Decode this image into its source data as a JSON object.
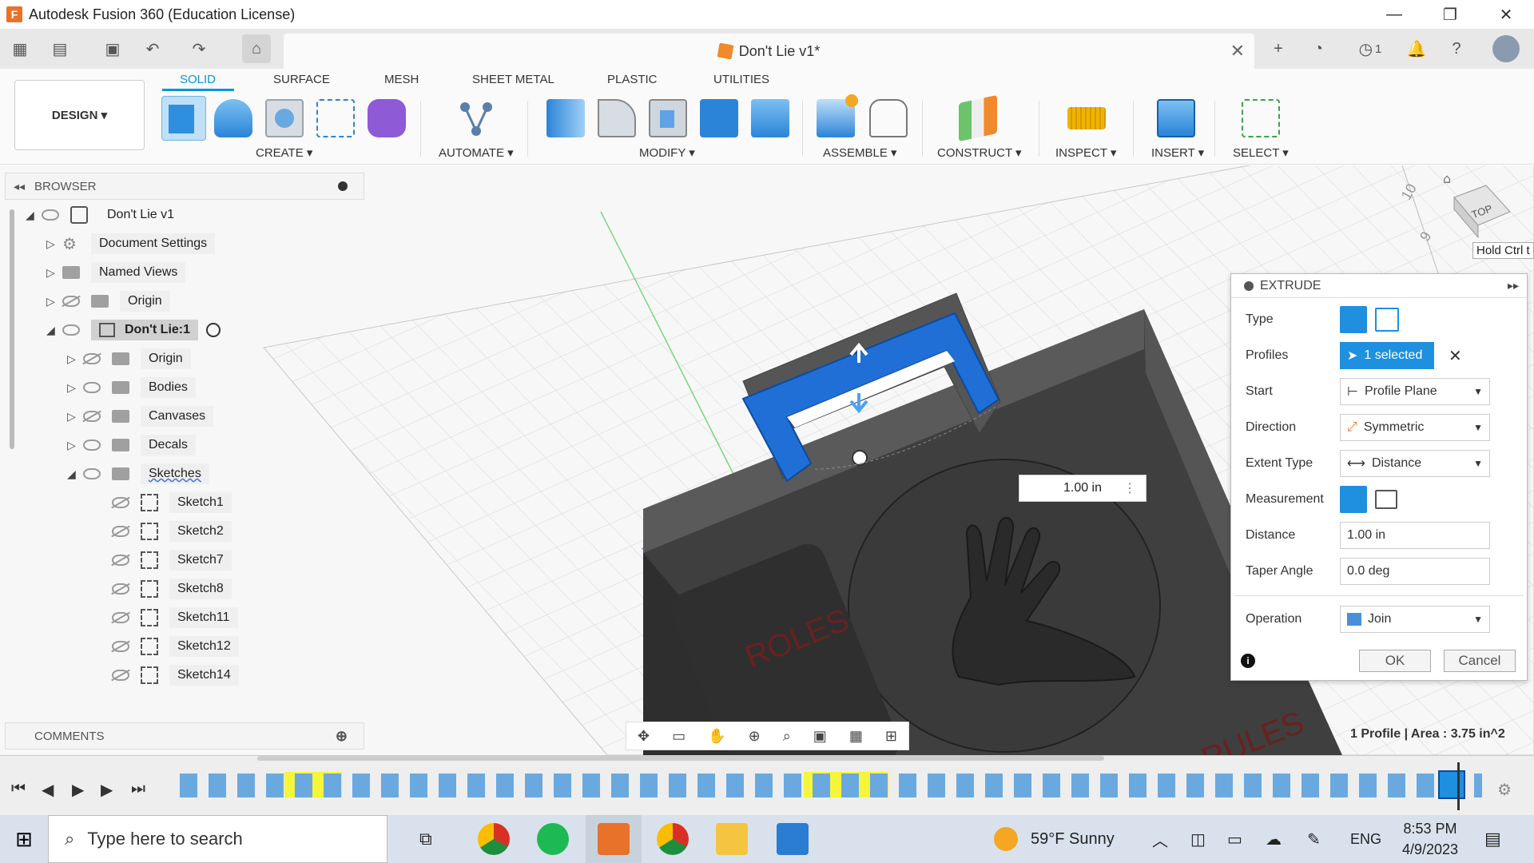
{
  "window": {
    "title": "Autodesk Fusion 360 (Education License)",
    "logo_letter": "F",
    "minimize": "—",
    "maximize": "❐",
    "close": "✕"
  },
  "document": {
    "tab_title": "Don't Lie v1*",
    "close": "✕",
    "job_count": "1"
  },
  "ribbon": {
    "workspace": "DESIGN ▾",
    "tabs": [
      "SOLID",
      "SURFACE",
      "MESH",
      "SHEET METAL",
      "PLASTIC",
      "UTILITIES"
    ],
    "groups": [
      "CREATE ▾",
      "AUTOMATE ▾",
      "MODIFY ▾",
      "ASSEMBLE ▾",
      "CONSTRUCT ▾",
      "INSPECT ▾",
      "INSERT ▾",
      "SELECT ▾"
    ]
  },
  "browser": {
    "title": "BROWSER",
    "items": [
      {
        "label": "Don't Lie v1"
      },
      {
        "label": "Document Settings"
      },
      {
        "label": "Named Views"
      },
      {
        "label": "Origin"
      },
      {
        "label": "Don't Lie:1"
      },
      {
        "label": "Origin"
      },
      {
        "label": "Bodies"
      },
      {
        "label": "Canvases"
      },
      {
        "label": "Decals"
      },
      {
        "label": "Sketches"
      },
      {
        "label": "Sketch1"
      },
      {
        "label": "Sketch2"
      },
      {
        "label": "Sketch7"
      },
      {
        "label": "Sketch8"
      },
      {
        "label": "Sketch11"
      },
      {
        "label": "Sketch12"
      },
      {
        "label": "Sketch14"
      }
    ]
  },
  "comments": {
    "title": "COMMENTS"
  },
  "viewport": {
    "dimension_value": "1.00 in",
    "viewcube_label": "TOP",
    "hold_ctrl": "Hold Ctrl t",
    "axis_10": "10",
    "axis_9": "9",
    "profile_area": "1 Profile | Area : 3.75 in^2",
    "decal_roles": "ROLES",
    "decal_rules": "RULES"
  },
  "extrude": {
    "title": "EXTRUDE",
    "rows": {
      "type": "Type",
      "profiles": "Profiles",
      "profiles_value": "1 selected",
      "start": "Start",
      "start_value": "Profile Plane",
      "direction": "Direction",
      "direction_value": "Symmetric",
      "extent_type": "Extent Type",
      "extent_value": "Distance",
      "measurement": "Measurement",
      "distance": "Distance",
      "distance_value": "1.00 in",
      "taper": "Taper Angle",
      "taper_value": "0.0 deg",
      "operation": "Operation",
      "operation_value": "Join"
    },
    "ok": "OK",
    "cancel": "Cancel"
  },
  "taskbar": {
    "search_placeholder": "Type here to search",
    "weather": "59°F  Sunny",
    "lang": "ENG",
    "time": "8:53 PM",
    "date": "4/9/2023"
  },
  "colors": {
    "accent": "#0696d7",
    "selection_blue": "#1f6fd6",
    "body_gray": "#4a4a4a",
    "timeline_highlight": "#f5f53a"
  }
}
